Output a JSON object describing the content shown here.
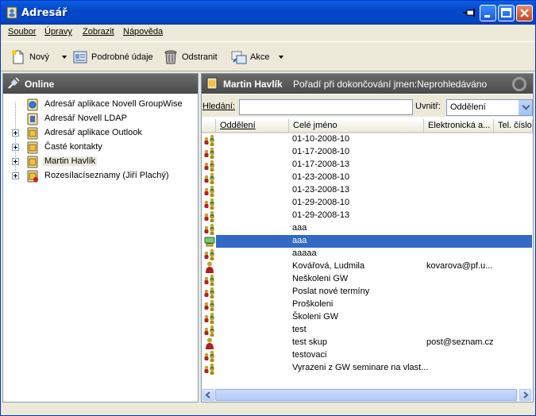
{
  "window": {
    "title": "Adresář"
  },
  "menu": [
    "Soubor",
    "Úpravy",
    "Zobrazit",
    "Nápověda"
  ],
  "toolbar": {
    "new_label": "Nový",
    "details_label": "Podrobné údaje",
    "delete_label": "Odstranit",
    "actions_label": "Akce"
  },
  "left": {
    "header": "Online",
    "items": [
      {
        "label": "Adresář aplikace Novell GroupWise",
        "icon": "groupwise-book-icon"
      },
      {
        "label": "Adresář Novell LDAP",
        "icon": "ldap-book-icon"
      },
      {
        "label": "Adresář aplikace Outlook",
        "icon": "outlook-book-icon"
      },
      {
        "label": "Časté kontakty",
        "icon": "book-icon"
      },
      {
        "label": "Martin Havlík",
        "icon": "book-icon"
      },
      {
        "label": "Rozesílacíseznamy (Jiří Plachý)",
        "icon": "distribution-list-icon"
      }
    ]
  },
  "right": {
    "header_name": "Martin Havlík",
    "header_info": "Pořadí při dokončování jmen:Neprohledáváno",
    "search_label": "Hledání:",
    "search_value": "",
    "within_label": "Uvnitř:",
    "within_value": "Oddělení",
    "columns": [
      "Oddělení",
      "Celé jméno",
      "Elektronická a...",
      "Tel. číslo"
    ],
    "rows": [
      {
        "name": "01-10-2008-10",
        "email": "",
        "icon": "group-icon"
      },
      {
        "name": "01-17-2008-10",
        "email": "",
        "icon": "group-icon"
      },
      {
        "name": "01-17-2008-13",
        "email": "",
        "icon": "group-icon"
      },
      {
        "name": "01-23-2008-10",
        "email": "",
        "icon": "group-icon"
      },
      {
        "name": "01-23-2008-13",
        "email": "",
        "icon": "group-icon"
      },
      {
        "name": "01-29-2008-10",
        "email": "",
        "icon": "group-icon"
      },
      {
        "name": "01-29-2008-13",
        "email": "",
        "icon": "group-icon"
      },
      {
        "name": "aaa",
        "email": "",
        "icon": "group-icon"
      },
      {
        "name": "aaa",
        "email": "",
        "icon": "resource-icon",
        "selected": true
      },
      {
        "name": "aaaaa",
        "email": "",
        "icon": "group-icon"
      },
      {
        "name": "Kovářová, Ludmila",
        "email": "kovarova@pf.u...",
        "icon": "person-icon"
      },
      {
        "name": "Neškoleni GW",
        "email": "",
        "icon": "group-icon"
      },
      {
        "name": "Poslat nové termíny",
        "email": "",
        "icon": "group-icon"
      },
      {
        "name": "Proškoleni",
        "email": "",
        "icon": "group-icon"
      },
      {
        "name": "Školeni GW",
        "email": "",
        "icon": "group-icon"
      },
      {
        "name": "test",
        "email": "",
        "icon": "group-icon"
      },
      {
        "name": "test skup",
        "email": "post@seznam.cz",
        "icon": "person-icon"
      },
      {
        "name": "testovaci",
        "email": "",
        "icon": "group-icon"
      },
      {
        "name": "Vyrazeni z GW seminare na vlast...",
        "email": "",
        "icon": "group-icon"
      }
    ]
  },
  "colors": {
    "titlebar": "#0447C9",
    "pane_header": "#5A5A5A",
    "selection": "#316AC5"
  }
}
